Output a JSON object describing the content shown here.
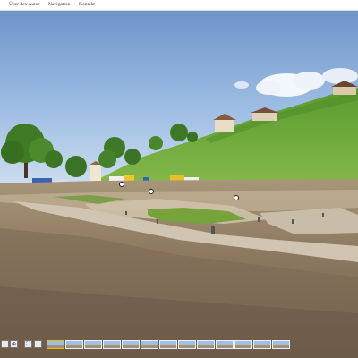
{
  "nav": {
    "items": [
      {
        "label": "Über den Autor"
      },
      {
        "label": "Navigation"
      },
      {
        "label": "Kontakt"
      }
    ]
  },
  "controls": [
    {
      "icon": "menu-icon",
      "glyph": ""
    },
    {
      "icon": "zoom-icon",
      "glyph": "⊕"
    },
    {
      "icon": "fullscreen-icon",
      "glyph": "⛶"
    },
    {
      "icon": "info-icon",
      "glyph": ""
    }
  ],
  "thumbnails": {
    "count": 13,
    "active_index": 0
  },
  "colors": {
    "active_thumb_border": "#f0c000",
    "nav_background": "#ffffff"
  }
}
